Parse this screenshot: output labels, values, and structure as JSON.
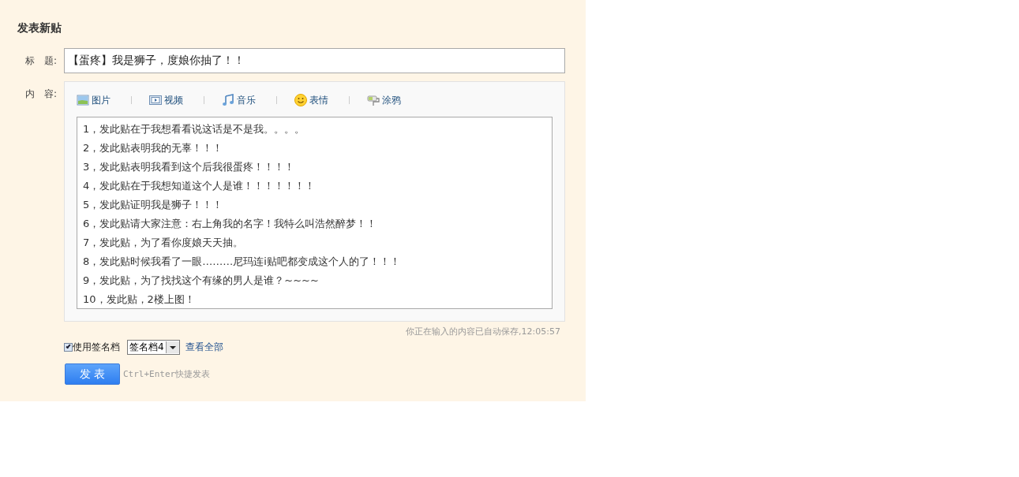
{
  "heading": "发表新贴",
  "title_field": {
    "label": "标　题:",
    "value": "【蛋疼】我是狮子，度娘你抽了！！"
  },
  "content": {
    "label": "内　容:",
    "toolbar": [
      {
        "kind": "image",
        "label": "图片"
      },
      {
        "kind": "video",
        "label": "视频"
      },
      {
        "kind": "music",
        "label": "音乐"
      },
      {
        "kind": "emoji",
        "label": "表情"
      },
      {
        "kind": "doodle",
        "label": "涂鸦"
      }
    ],
    "lines": [
      "1，发此贴在于我想看看说这话是不是我。。。。",
      "2，发此贴表明我的无辜！！！",
      "3，发此贴表明我看到这个后我很蛋疼！！！！",
      "4，发此贴在于我想知道这个人是谁！！！！！！！",
      "5，发此贴证明我是狮子！！！",
      "6，发此贴请大家注意：右上角我的名字！我特么叫浩然醉梦！！",
      "7，发此贴，为了看你度娘天天抽。",
      "8，发此贴时候我看了一眼………尼玛连i贴吧都变成这个人的了！！！",
      "9，发此贴，为了找找这个有缘的男人是谁？~~~~",
      "10，发此贴，2楼上图！"
    ]
  },
  "autosave_note": "你正在输入的内容已自动保存,12:05:57",
  "signature": {
    "checked": true,
    "label": "使用签名档",
    "value": "签名档4",
    "view_all": "查看全部"
  },
  "submit": "发 表",
  "shortcut_hint": "Ctrl+Enter快捷发表"
}
